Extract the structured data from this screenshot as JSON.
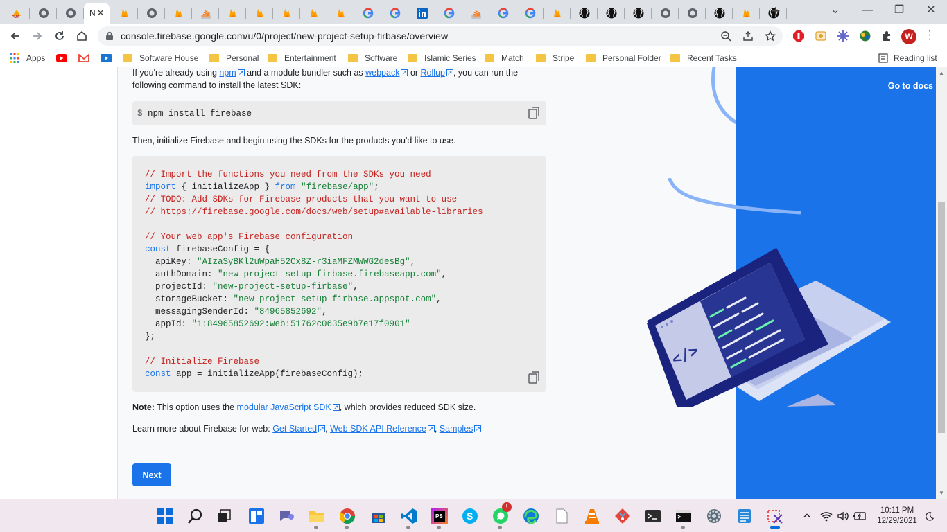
{
  "browser": {
    "active_tab": {
      "title": "N",
      "close": "✕"
    },
    "tabs": [
      {
        "icon": "pma-icon"
      },
      {
        "icon": "globe-icon"
      },
      {
        "icon": "globe-icon"
      },
      {
        "icon": "firebase-icon"
      },
      {
        "icon": "globe-icon"
      },
      {
        "icon": "firebase-icon"
      },
      {
        "icon": "stack-icon"
      },
      {
        "icon": "firebase-icon"
      },
      {
        "icon": "firebase-icon"
      },
      {
        "icon": "firebase-icon"
      },
      {
        "icon": "firebase-icon"
      },
      {
        "icon": "firebase-icon"
      },
      {
        "icon": "google-icon"
      },
      {
        "icon": "google-icon"
      },
      {
        "icon": "linkedin-icon"
      },
      {
        "icon": "google-icon"
      },
      {
        "icon": "stack-icon"
      },
      {
        "icon": "google-icon"
      },
      {
        "icon": "google-icon"
      },
      {
        "icon": "firebase-icon"
      },
      {
        "icon": "github-icon"
      },
      {
        "icon": "github-icon"
      },
      {
        "icon": "github-icon"
      },
      {
        "icon": "globe-icon"
      },
      {
        "icon": "globe-icon"
      },
      {
        "icon": "github-icon"
      },
      {
        "icon": "firebase-icon"
      },
      {
        "icon": "github-icon"
      }
    ],
    "new_tab": "+",
    "window_controls": {
      "dropdown": "⌄",
      "minimize": "—",
      "restore": "❐",
      "close": "✕"
    },
    "url": "console.firebase.google.com/u/0/project/new-project-setup-firbase/overview",
    "profile_initial": "W"
  },
  "bookmarks": {
    "apps": "Apps",
    "folders": [
      "Software House",
      "Personal",
      "Entertainment",
      "Software",
      "Islamic Series",
      "Match",
      "Stripe",
      "Personal Folder",
      "Recent Tasks"
    ],
    "reading_list": "Reading list"
  },
  "page": {
    "intro": {
      "part1": "If you're already using ",
      "npm": "npm",
      "part2": " and a module bundler such as ",
      "webpack": "webpack",
      "part3": " or ",
      "rollup": "Rollup",
      "part4": ", you can run the",
      "line2": "following command to install the latest SDK:"
    },
    "install_command": {
      "prompt": "$",
      "command": "npm install firebase"
    },
    "then_text": "Then, initialize Firebase and begin using the SDKs for the products you'd like to use.",
    "code": {
      "l1": "// Import the functions you need from the SDKs you need",
      "l2_import": "import",
      "l2_mid": " { initializeApp } ",
      "l2_from": "from",
      "l2_str": " \"firebase/app\"",
      "l2_end": ";",
      "l3": "// TODO: Add SDKs for Firebase products that you want to use",
      "l4": "// https://firebase.google.com/docs/web/setup#available-libraries",
      "l5": "// Your web app's Firebase configuration",
      "l6_const": "const",
      "l6_rest": " firebaseConfig = {",
      "api_key_label": "  apiKey: ",
      "api_key": "\"AIzaSyBKl2uWpaH52Cx8Z-r3iaMFZMWWG2desBg\"",
      "auth_domain_label": "  authDomain: ",
      "auth_domain": "\"new-project-setup-firbase.firebaseapp.com\"",
      "project_id_label": "  projectId: ",
      "project_id": "\"new-project-setup-firbase\"",
      "storage_bucket_label": "  storageBucket: ",
      "storage_bucket": "\"new-project-setup-firbase.appspot.com\"",
      "sender_label": "  messagingSenderId: ",
      "sender_id": "\"84965852692\"",
      "app_id_label": "  appId: ",
      "app_id": "\"1:84965852692:web:51762c0635e9b7e17f0901\"",
      "close_obj": "};",
      "l_init_comment": "// Initialize Firebase",
      "l_init_const": "const",
      "l_init_rest": " app = initializeApp(firebaseConfig);",
      "comma": ","
    },
    "note": {
      "label": "Note:",
      "text1": " This option uses the ",
      "link": "modular JavaScript SDK",
      "text2": ", which provides reduced SDK size."
    },
    "learn": {
      "text": "Learn more about Firebase for web: ",
      "get_started": "Get Started",
      "api_ref": "Web SDK API Reference",
      "samples": "Samples",
      "sep": ", "
    },
    "next_button": "Next",
    "goto_docs": "Go to docs",
    "laptop_tag": "</>"
  },
  "taskbar": {
    "apps": [
      "start-icon",
      "search-icon",
      "task-view-icon",
      "widgets-icon",
      "chat-icon",
      "file-explorer-icon",
      "chrome-icon",
      "store-icon",
      "vscode-icon",
      "phpstorm-icon",
      "skype-icon",
      "whatsapp-icon",
      "edge-icon",
      "notepad-icon",
      "vlc-icon",
      "git-icon",
      "terminal-icon",
      "cmd-icon",
      "settings-icon",
      "notes-icon",
      "snipping-icon"
    ],
    "clock": {
      "time": "10:11 PM",
      "date": "12/29/2021"
    },
    "phpstorm_label": "PS",
    "skype_label": "S",
    "whatsapp_badge": "!"
  }
}
